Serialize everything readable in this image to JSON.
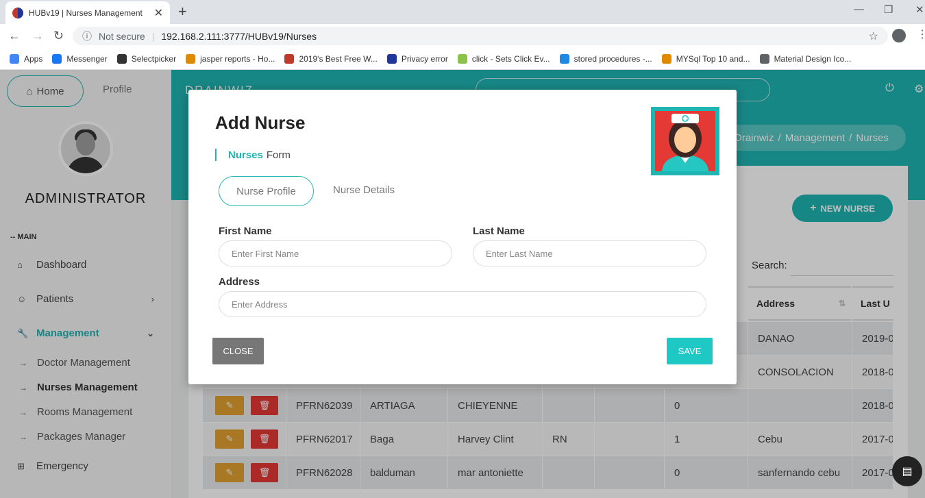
{
  "browser": {
    "tab_title": "HUBv19 | Nurses Management",
    "not_secure": "Not secure",
    "url": "192.168.2.111:3777/HUBv19/Nurses",
    "bookmarks": [
      "Apps",
      "Messenger",
      "Selectpicker",
      "jasper reports - Ho...",
      "2019's Best Free W...",
      "Privacy error",
      "click - Sets Click Ev...",
      "stored procedures -...",
      "MYSql Top 10 and...",
      "Material Design Ico..."
    ],
    "bookmark_colors": [
      "#4285f4",
      "#1877f2",
      "#333333",
      "#e08a00",
      "#c0392b",
      "#1e3799",
      "#8bc34a",
      "#1e88e5",
      "#e08a00",
      "#5f6368"
    ]
  },
  "sidebar": {
    "home": "Home",
    "profile": "Profile",
    "user": "ADMINISTRATOR",
    "section": "-- MAIN",
    "items": [
      {
        "label": "Dashboard",
        "icon": "home-icon"
      },
      {
        "label": "Patients",
        "icon": "face-icon"
      },
      {
        "label": "Management",
        "icon": "wrench-icon"
      },
      {
        "label": "Emergency",
        "icon": "plus-box-icon"
      }
    ],
    "subitems": [
      "Doctor Management",
      "Nurses Management",
      "Rooms Management",
      "Packages Manager"
    ]
  },
  "topbar": {
    "brand": "DRAINWIZ",
    "breadcrumb": [
      "Drainwiz",
      "Management",
      "Nurses"
    ]
  },
  "page": {
    "new_button": "NEW NURSE",
    "search_label": "Search:"
  },
  "table": {
    "headers": {
      "address": "Address",
      "last": "Last U"
    },
    "rows": [
      {
        "id": "",
        "last": "",
        "first": "",
        "title": "",
        "x": "",
        "n": "",
        "address": "DANAO",
        "date": "2019-0"
      },
      {
        "id": "",
        "last": "",
        "first": "",
        "title": "",
        "x": "",
        "n": "",
        "address": "CONSOLACION",
        "date": "2018-0"
      },
      {
        "id": "PFRN62039",
        "last": "ARTIAGA",
        "first": "CHIEYENNE",
        "title": "",
        "x": "",
        "n": "0",
        "address": "",
        "date": "2018-0"
      },
      {
        "id": "PFRN62017",
        "last": "Baga",
        "first": "Harvey Clint",
        "title": "RN",
        "x": "",
        "n": "1",
        "address": "Cebu",
        "date": "2017-0"
      },
      {
        "id": "PFRN62028",
        "last": "balduman",
        "first": "mar antoniette",
        "title": "",
        "x": "",
        "n": "0",
        "address": "sanfernando cebu",
        "date": "2017-0"
      }
    ]
  },
  "modal": {
    "title": "Add Nurse",
    "form_label_bold": "Nurses",
    "form_label_rest": "Form",
    "tab_profile": "Nurse Profile",
    "tab_details": "Nurse Details",
    "first_name_label": "First Name",
    "first_name_placeholder": "Enter First Name",
    "last_name_label": "Last Name",
    "last_name_placeholder": "Enter Last Name",
    "address_label": "Address",
    "address_placeholder": "Enter Address",
    "close": "CLOSE",
    "save": "SAVE"
  }
}
